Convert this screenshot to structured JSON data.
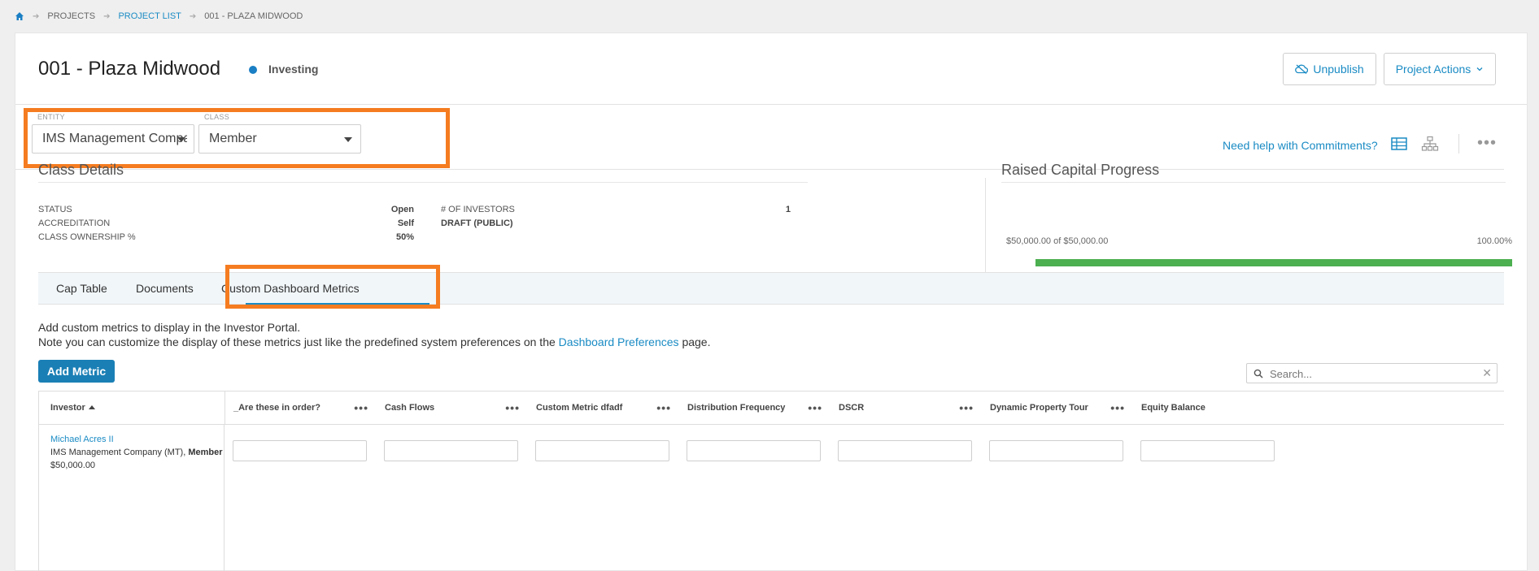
{
  "breadcrumb": {
    "items": [
      "PROJECTS",
      "PROJECT LIST",
      "001 - PLAZA MIDWOOD"
    ]
  },
  "header": {
    "title": "001 - Plaza Midwood",
    "status": "Investing",
    "status_color": "#1a7fc4",
    "unpublish_label": "Unpublish",
    "actions_label": "Project Actions"
  },
  "filters": {
    "entity_label": "ENTITY",
    "entity_value": "IMS Management Company...",
    "class_label": "CLASS",
    "class_value": "Member",
    "help_link": "Need help with Commitments?"
  },
  "class_details": {
    "title": "Class Details",
    "status_label": "STATUS",
    "status_value": "Open",
    "accreditation_label": "ACCREDITATION",
    "accreditation_value": "Self",
    "ownership_label": "CLASS OWNERSHIP %",
    "ownership_value": "50%",
    "investors_label": "# OF INVESTORS",
    "investors_value": "1",
    "draft_label": "DRAFT (PUBLIC)"
  },
  "raised_capital": {
    "title": "Raised Capital Progress",
    "amount_text": "$50,000.00 of $50,000.00",
    "percent_text": "100.00%",
    "progress_fraction": 1.0,
    "bar_color": "#4caf50"
  },
  "tabs": [
    "Cap Table",
    "Documents",
    "Custom Dashboard Metrics"
  ],
  "active_tab": "Custom Dashboard Metrics",
  "description": {
    "line1": "Add custom metrics to display in the Investor Portal.",
    "line2_prefix": "Note you can customize the display of these metrics just like the predefined system preferences on the",
    "line2_link": "Dashboard Preferences",
    "line2_suffix": "page."
  },
  "add_metric_label": "Add Metric",
  "search": {
    "placeholder": "Search..."
  },
  "table": {
    "investor_header": "Investor",
    "columns": [
      "_Are these in order?",
      "Cash Flows",
      "Custom Metric dfadf",
      "Distribution Frequency",
      "DSCR",
      "Dynamic Property Tour",
      "Equity Balance"
    ],
    "rows": [
      {
        "name": "Michael Acres II",
        "entity": "IMS Management Company (MT),",
        "class": "Member",
        "amount": "$50,000.00"
      }
    ]
  },
  "colors": {
    "accent": "#1a8bc4",
    "primary_button": "#1a7fb5",
    "highlight": "#f57c20"
  }
}
